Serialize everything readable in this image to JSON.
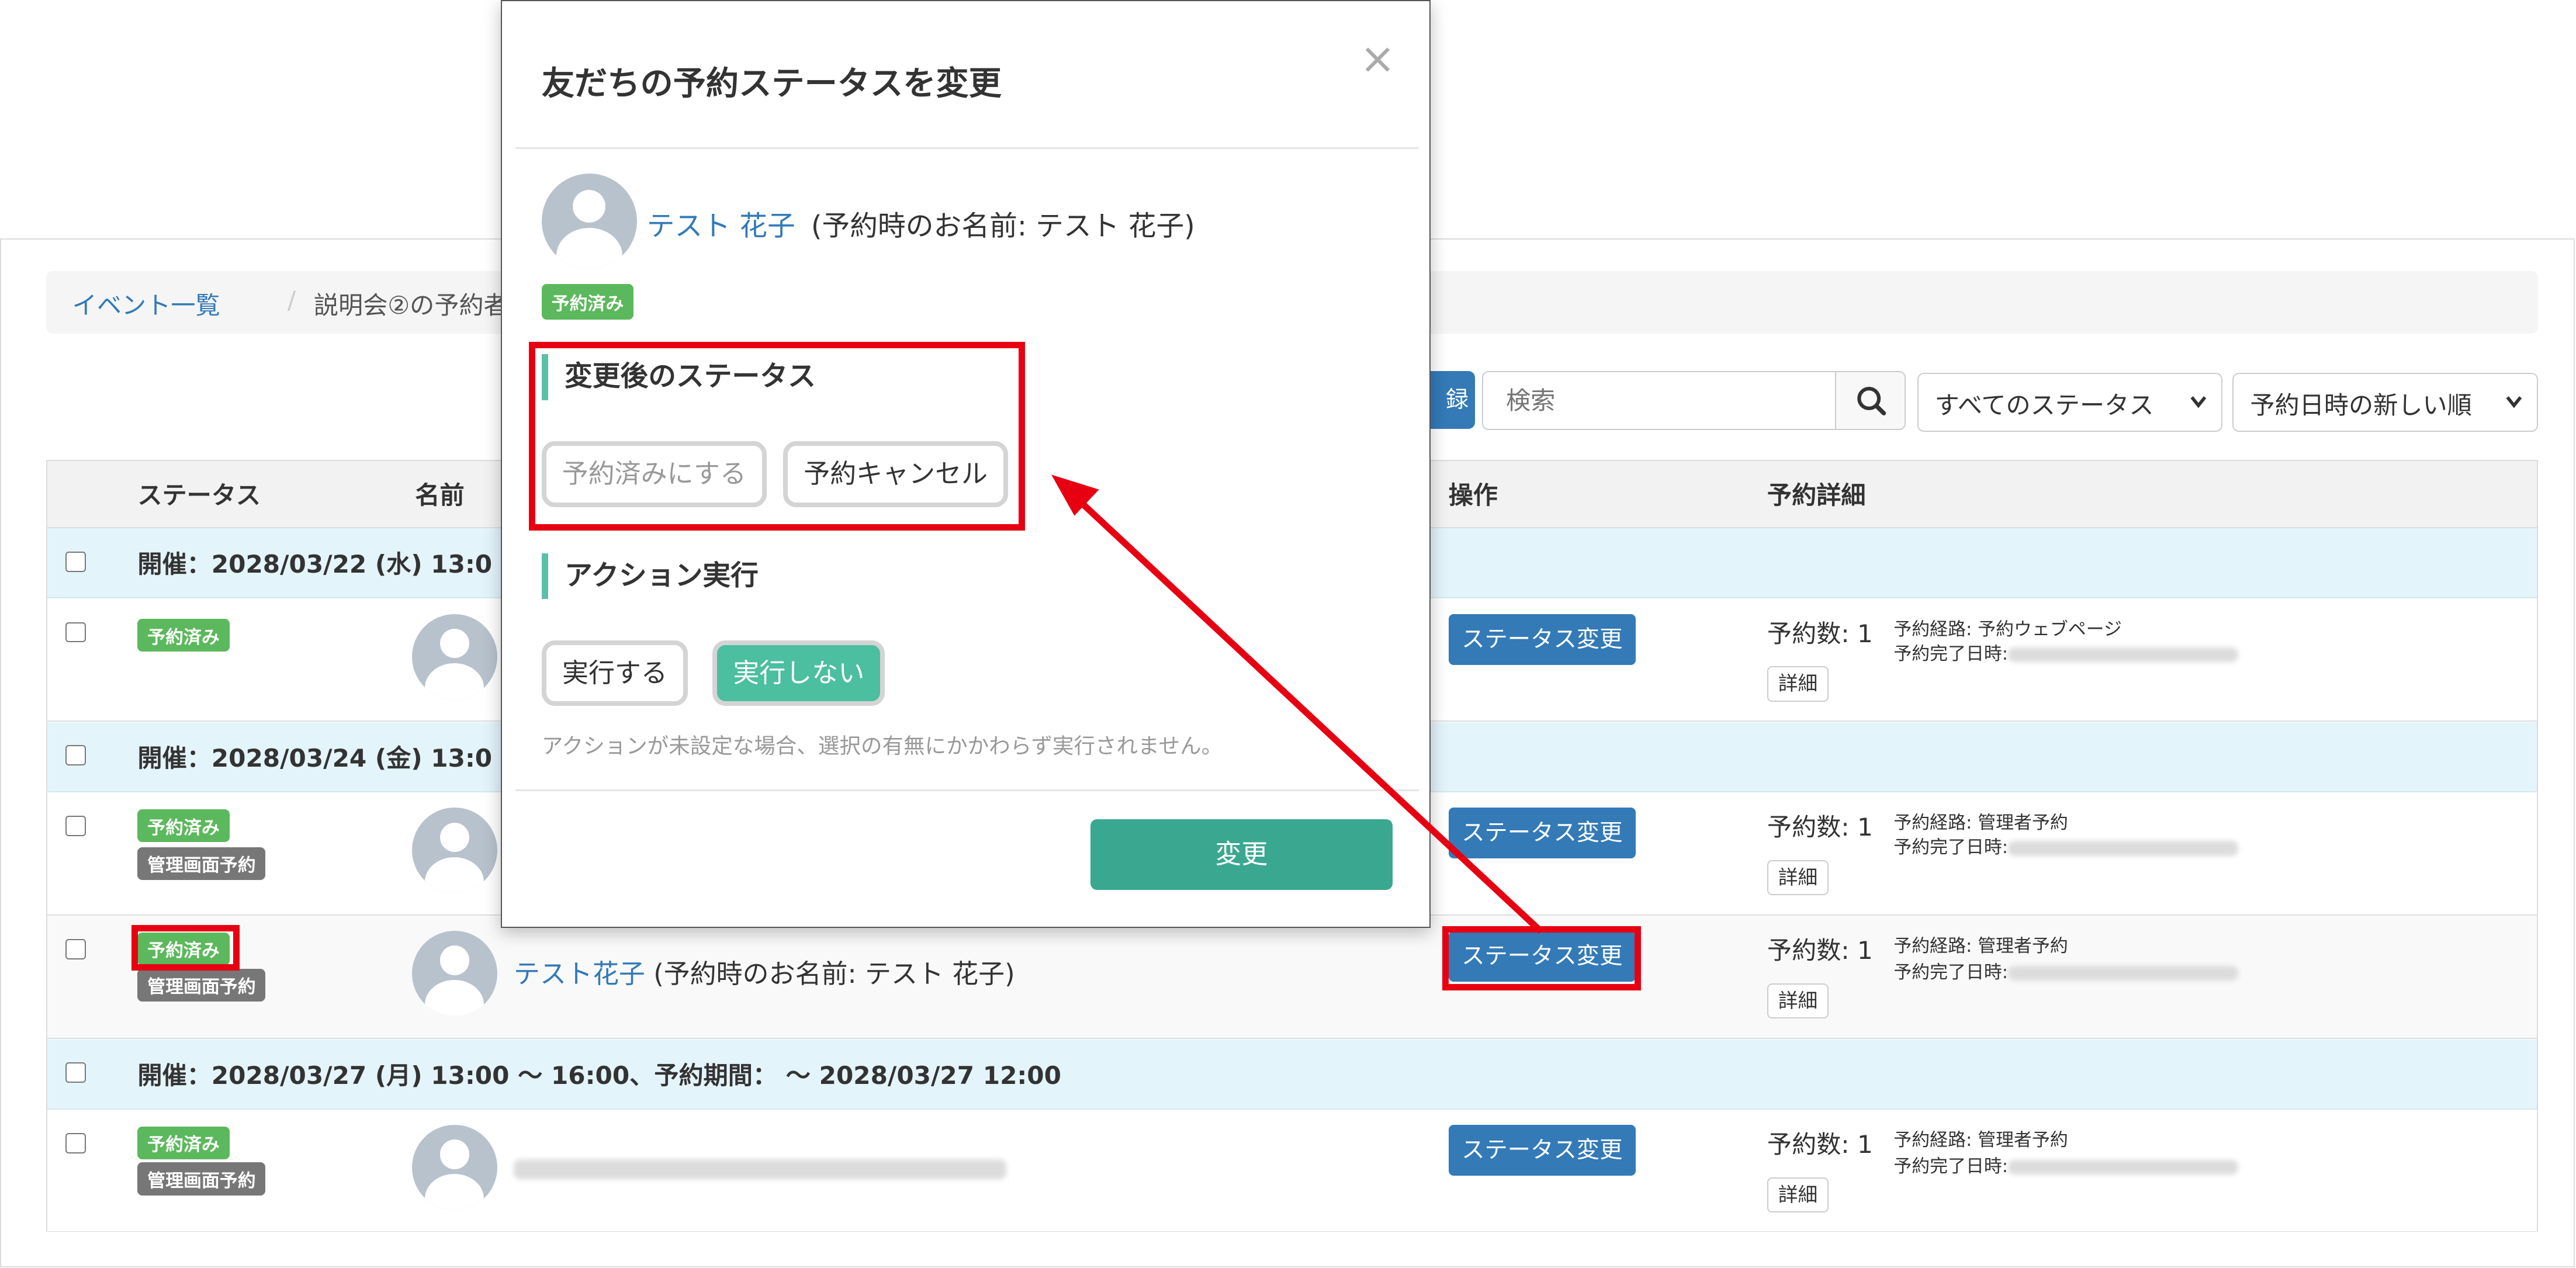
{
  "breadcrumb": {
    "link": "イベント一覧",
    "separator": "/",
    "current": "説明会②の予約者一覧"
  },
  "toolbar": {
    "register_label": "録",
    "search_placeholder": "検索",
    "status_select": "すべてのステータス",
    "sort_select": "予約日時の新しい順"
  },
  "table": {
    "headers": {
      "status": "ステータス",
      "name": "名前",
      "operation": "操作",
      "detail": "予約詳細"
    },
    "groups": [
      "開催：2028/03/22 (水) 13:0",
      "開催：2028/03/24 (金) 13:0",
      "開催：2028/03/27 (月) 13:00 ～ 16:00、予約期間： ～ 2028/03/27 12:00"
    ],
    "rows": [
      {
        "status": "予約済み",
        "op": "ステータス変更",
        "count": "予約数: 1",
        "route": "予約経路: 予約ウェブページ",
        "done": "予約完了日時:",
        "detail_btn": "詳細"
      },
      {
        "status": "予約済み",
        "sub_status": "管理画面予約",
        "op": "ステータス変更",
        "count": "予約数: 1",
        "route": "予約経路: 管理者予約",
        "done": "予約完了日時:",
        "detail_btn": "詳細"
      },
      {
        "status": "予約済み",
        "sub_status": "管理画面予約",
        "name": "テスト花子",
        "name_rest": " (予約時のお名前: テスト 花子)",
        "op": "ステータス変更",
        "count": "予約数: 1",
        "route": "予約経路: 管理者予約",
        "done": "予約完了日時:",
        "detail_btn": "詳細"
      },
      {
        "status": "予約済み",
        "sub_status": "管理画面予約",
        "op": "ステータス変更",
        "count": "予約数: 1",
        "route": "予約経路: 管理者予約",
        "done": "予約完了日時:",
        "detail_btn": "詳細"
      }
    ]
  },
  "modal": {
    "title": "友だちの予約ステータスを変更",
    "close": "×",
    "friend_name": "テスト 花子",
    "reservation_name": "(予約時のお名前: テスト 花子)",
    "badge": "予約済み",
    "section_status": "変更後のステータス",
    "btn_reserved": "予約済みにする",
    "btn_cancel": "予約キャンセル",
    "section_action": "アクション実行",
    "btn_execute": "実行する",
    "btn_no_execute": "実行しない",
    "note": "アクションが未設定な場合、選択の有無にかかわらず実行されません。",
    "submit": "変更"
  },
  "colors": {
    "primary": "#337ab7",
    "success": "#5cb85c",
    "teal": "#3aa891",
    "highlight": "#e60012",
    "group_bg": "#e4f4fb"
  }
}
